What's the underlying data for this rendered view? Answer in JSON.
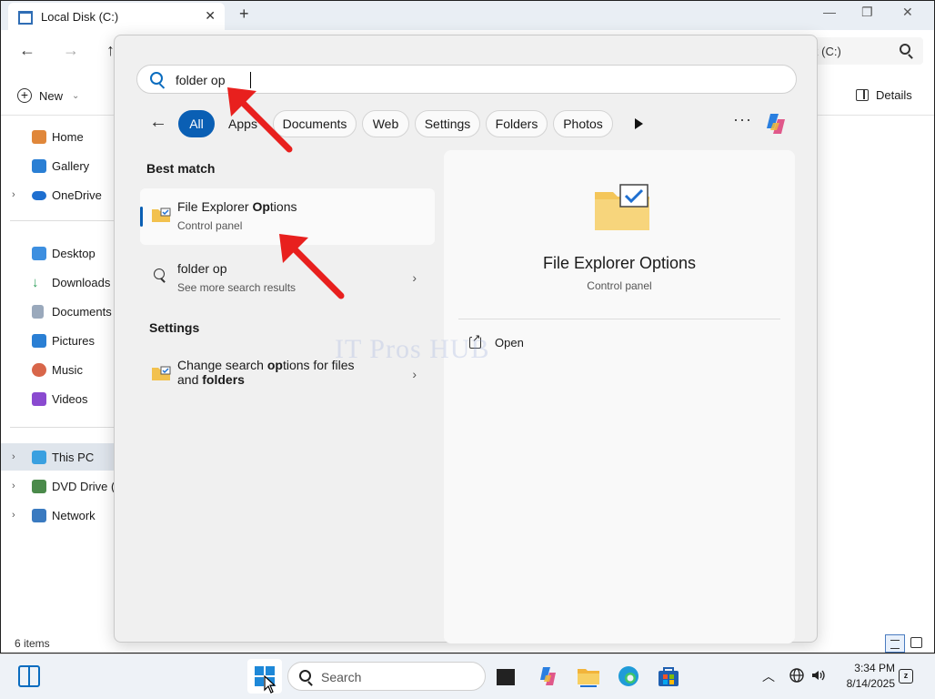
{
  "explorer": {
    "tab_title": "Local Disk (C:)",
    "tab_close": "✕",
    "tab_add": "+",
    "minimize": "—",
    "maximize": "❐",
    "close": "✕",
    "address": "k (C:)",
    "new_label": "New",
    "details_label": "Details",
    "status": "6 items",
    "sidebar": [
      {
        "label": "Home",
        "icon": "home-icon",
        "color": "#e0873a"
      },
      {
        "label": "Gallery",
        "icon": "gallery-icon",
        "color": "#2a7fd4"
      },
      {
        "label": "OneDrive",
        "icon": "onedrive-icon",
        "color": "#1e6fd0"
      },
      {
        "label": "Desktop",
        "icon": "desktop-icon",
        "color": "#3d8fe0"
      },
      {
        "label": "Downloads",
        "icon": "downloads-icon",
        "color": "#2a9d58"
      },
      {
        "label": "Documents",
        "icon": "documents-icon",
        "color": "#7b8ca3"
      },
      {
        "label": "Pictures",
        "icon": "pictures-icon",
        "color": "#2a7fd4"
      },
      {
        "label": "Music",
        "icon": "music-icon",
        "color": "#d8664a"
      },
      {
        "label": "Videos",
        "icon": "videos-icon",
        "color": "#8a4ad0"
      },
      {
        "label": "This PC",
        "icon": "this-pc-icon",
        "color": "#3aa0e0"
      },
      {
        "label": "DVD Drive (D:",
        "icon": "dvd-drive-icon",
        "color": "#4a8a4a"
      },
      {
        "label": "Network",
        "icon": "network-icon",
        "color": "#3a7ac0"
      }
    ]
  },
  "search": {
    "query": "folder op",
    "filters": [
      "All",
      "Apps",
      "Documents",
      "Web",
      "Settings",
      "Folders",
      "Photos"
    ],
    "more": "···",
    "best_match_title": "Best match",
    "best_match": {
      "title_pre": "File Explorer ",
      "title_bold": "Op",
      "title_post": "tions",
      "subtitle": "Control panel"
    },
    "web_result": {
      "title": "folder op",
      "subtitle": "See more search results"
    },
    "settings_title": "Settings",
    "settings_result": {
      "line1_pre": "Change search ",
      "line1_bold": "op",
      "line1_post": "tions for files",
      "line2_pre": "and ",
      "line2_bold": "folders"
    },
    "detail": {
      "title": "File Explorer Options",
      "subtitle": "Control panel",
      "open_label": "Open"
    },
    "watermark": "IT Pros HUB"
  },
  "taskbar": {
    "search_label": "Search",
    "time": "3:34 PM",
    "date": "8/14/2025",
    "chevron": "︿"
  },
  "colors": {
    "accent": "#0a5fb4",
    "annotation": "#e8201e"
  }
}
